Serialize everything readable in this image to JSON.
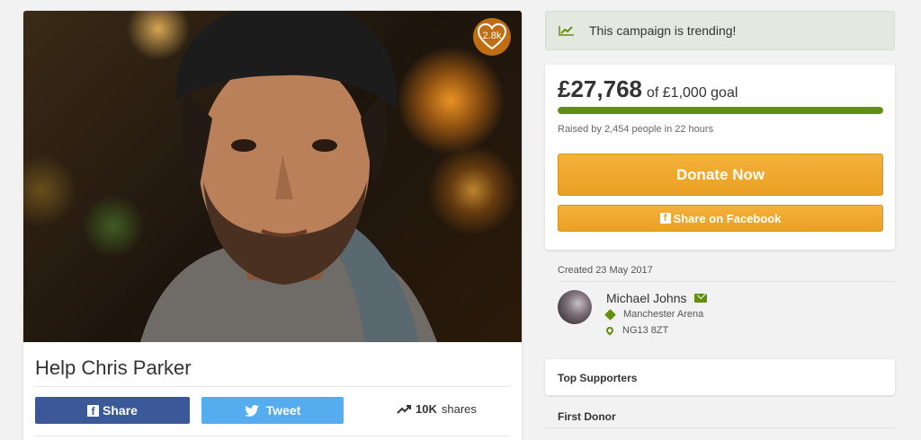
{
  "campaign": {
    "title": "Help Chris Parker",
    "hearts": "2.8k",
    "photo_alt": "Portrait photo"
  },
  "share_bar": {
    "share_label": "Share",
    "tweet_label": "Tweet",
    "shares_count": "10K",
    "shares_suffix": "shares"
  },
  "trending": {
    "text": "This campaign is trending!"
  },
  "fundraising": {
    "amount": "£27,768",
    "goal_text": "of £1,000 goal",
    "progress_fraction": 1.0,
    "raised_text": "Raised by 2,454 people in 22 hours",
    "donate_label": "Donate Now",
    "facebook_label": "Share on Facebook"
  },
  "organizer": {
    "created": "Created 23 May 2017",
    "name": "Michael Johns",
    "location": "Manchester Arena",
    "postcode": "NG13 8ZT"
  },
  "sections": {
    "top_supporters": "Top Supporters",
    "first_donor": "First Donor"
  },
  "colors": {
    "accent_green": "#638f0f",
    "facebook_blue": "#3b5998",
    "twitter_blue": "#55acee",
    "donate_orange": "#eaa024"
  }
}
